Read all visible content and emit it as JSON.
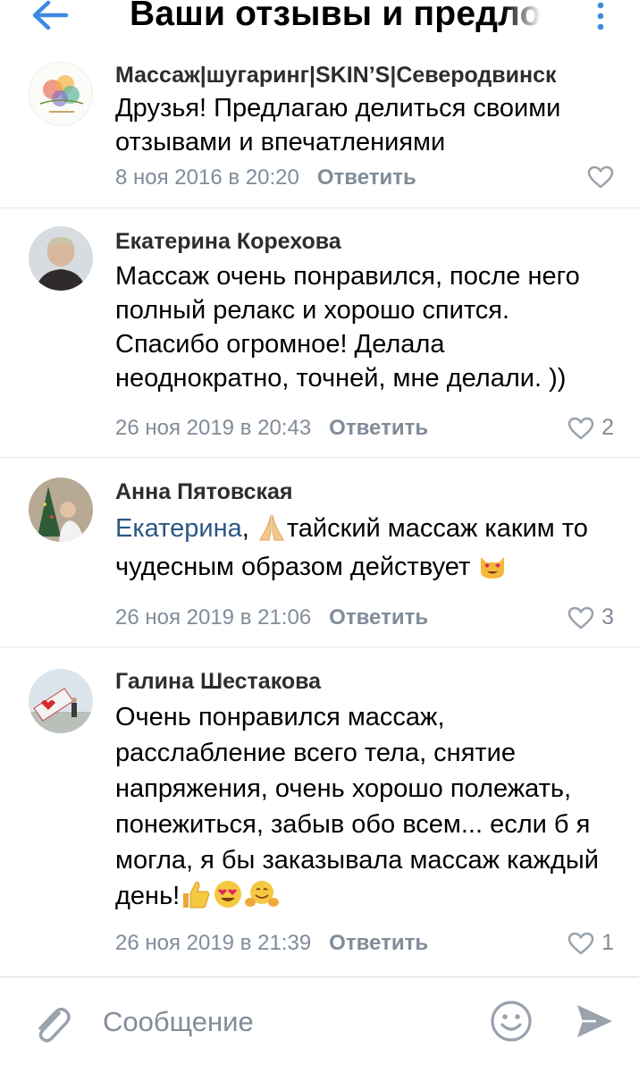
{
  "header": {
    "title": "Ваши отзывы и предложения",
    "back_icon": "arrow-left-icon",
    "more_icon": "more-vertical-icon",
    "accent": "#3f8ae0"
  },
  "comments": [
    {
      "author": "Массаж|шугаринг|SKIN’S|Северодвинск",
      "text": "Друзья! Предлагаю делиться своими отзывами и впечатлениями",
      "date": "8 ноя 2016 в 20:20",
      "reply_label": "Ответить",
      "likes": ""
    },
    {
      "author": "Екатерина Корехова",
      "text": "Массаж очень понравился, после него полный релакс и хорошо спится. Спасибо огромное! Делала неоднократно, точней, мне делали. ))",
      "date": "26 ноя 2019 в 20:43",
      "reply_label": "Ответить",
      "likes": "2"
    },
    {
      "author": "Анна Пятовская",
      "mention": "Екатерина",
      "text_after_mention": "тайский массаж каким то чудесным образом действует",
      "date": "26 ноя 2019 в 21:06",
      "reply_label": "Ответить",
      "likes": "3"
    },
    {
      "author": "Галина Шестакова",
      "text": "Очень понравился массаж, расслабление всего тела, снятие напряжения, очень хорошо полежать, понежиться, забыв обо всем... если б я могла, я бы заказывала массаж каждый день!",
      "date": "26 ноя 2019 в 21:39",
      "reply_label": "Ответить",
      "likes": "1"
    }
  ],
  "composer": {
    "placeholder": "Сообщение",
    "attach_icon": "paperclip-icon",
    "emoji_icon": "smile-icon",
    "send_icon": "send-icon"
  },
  "colors": {
    "secondary_text": "#818c99",
    "link": "#2a5885",
    "divider": "#e2e5e9"
  }
}
